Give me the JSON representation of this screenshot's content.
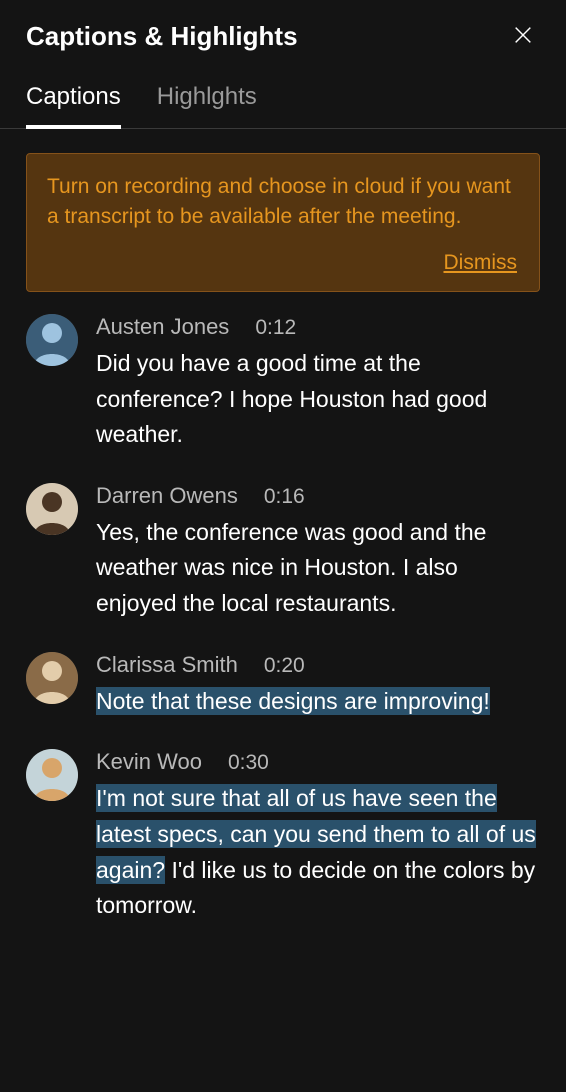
{
  "header": {
    "title": "Captions & Highlights"
  },
  "tabs": {
    "captions": "Captions",
    "highlights": "Highlghts"
  },
  "banner": {
    "message": "Turn on recording and choose in cloud if you want a transcript to be available after the meeting.",
    "dismiss": "Dismiss"
  },
  "captions": [
    {
      "speaker": "Austen Jones",
      "time": "0:12",
      "text_pre": "Did you have a good time at the conference? I hope Houston had good weather.",
      "text_hl": "",
      "text_post": ""
    },
    {
      "speaker": "Darren Owens",
      "time": "0:16",
      "text_pre": "Yes, the conference was good and the weather was nice in Houston. I also enjoyed the local restaurants.",
      "text_hl": "",
      "text_post": ""
    },
    {
      "speaker": "Clarissa Smith",
      "time": "0:20",
      "text_pre": "",
      "text_hl": "Note that these designs are improving!",
      "text_post": ""
    },
    {
      "speaker": "Kevin Woo",
      "time": "0:30",
      "text_pre": "",
      "text_hl": "I'm not sure that all of us have seen the latest specs, can you send them to all of us again?",
      "text_post": " I'd like us to decide on the colors by tomorrow."
    }
  ],
  "avatar_colors": [
    {
      "bg": "#3b5d78",
      "fg": "#9ec3df"
    },
    {
      "bg": "#d7c9b3",
      "fg": "#4a3524"
    },
    {
      "bg": "#8a6b48",
      "fg": "#e3cdab"
    },
    {
      "bg": "#c4d4d9",
      "fg": "#d8a56a"
    }
  ]
}
